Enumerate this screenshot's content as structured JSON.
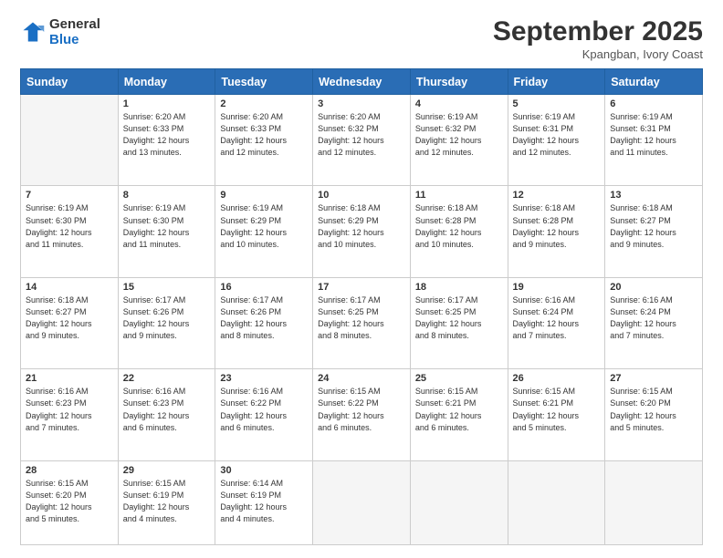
{
  "header": {
    "logo_line1": "General",
    "logo_line2": "Blue",
    "month": "September 2025",
    "location": "Kpangban, Ivory Coast"
  },
  "weekdays": [
    "Sunday",
    "Monday",
    "Tuesday",
    "Wednesday",
    "Thursday",
    "Friday",
    "Saturday"
  ],
  "weeks": [
    [
      {
        "day": "",
        "info": ""
      },
      {
        "day": "1",
        "info": "Sunrise: 6:20 AM\nSunset: 6:33 PM\nDaylight: 12 hours\nand 13 minutes."
      },
      {
        "day": "2",
        "info": "Sunrise: 6:20 AM\nSunset: 6:33 PM\nDaylight: 12 hours\nand 12 minutes."
      },
      {
        "day": "3",
        "info": "Sunrise: 6:20 AM\nSunset: 6:32 PM\nDaylight: 12 hours\nand 12 minutes."
      },
      {
        "day": "4",
        "info": "Sunrise: 6:19 AM\nSunset: 6:32 PM\nDaylight: 12 hours\nand 12 minutes."
      },
      {
        "day": "5",
        "info": "Sunrise: 6:19 AM\nSunset: 6:31 PM\nDaylight: 12 hours\nand 12 minutes."
      },
      {
        "day": "6",
        "info": "Sunrise: 6:19 AM\nSunset: 6:31 PM\nDaylight: 12 hours\nand 11 minutes."
      }
    ],
    [
      {
        "day": "7",
        "info": "Sunrise: 6:19 AM\nSunset: 6:30 PM\nDaylight: 12 hours\nand 11 minutes."
      },
      {
        "day": "8",
        "info": "Sunrise: 6:19 AM\nSunset: 6:30 PM\nDaylight: 12 hours\nand 11 minutes."
      },
      {
        "day": "9",
        "info": "Sunrise: 6:19 AM\nSunset: 6:29 PM\nDaylight: 12 hours\nand 10 minutes."
      },
      {
        "day": "10",
        "info": "Sunrise: 6:18 AM\nSunset: 6:29 PM\nDaylight: 12 hours\nand 10 minutes."
      },
      {
        "day": "11",
        "info": "Sunrise: 6:18 AM\nSunset: 6:28 PM\nDaylight: 12 hours\nand 10 minutes."
      },
      {
        "day": "12",
        "info": "Sunrise: 6:18 AM\nSunset: 6:28 PM\nDaylight: 12 hours\nand 9 minutes."
      },
      {
        "day": "13",
        "info": "Sunrise: 6:18 AM\nSunset: 6:27 PM\nDaylight: 12 hours\nand 9 minutes."
      }
    ],
    [
      {
        "day": "14",
        "info": "Sunrise: 6:18 AM\nSunset: 6:27 PM\nDaylight: 12 hours\nand 9 minutes."
      },
      {
        "day": "15",
        "info": "Sunrise: 6:17 AM\nSunset: 6:26 PM\nDaylight: 12 hours\nand 9 minutes."
      },
      {
        "day": "16",
        "info": "Sunrise: 6:17 AM\nSunset: 6:26 PM\nDaylight: 12 hours\nand 8 minutes."
      },
      {
        "day": "17",
        "info": "Sunrise: 6:17 AM\nSunset: 6:25 PM\nDaylight: 12 hours\nand 8 minutes."
      },
      {
        "day": "18",
        "info": "Sunrise: 6:17 AM\nSunset: 6:25 PM\nDaylight: 12 hours\nand 8 minutes."
      },
      {
        "day": "19",
        "info": "Sunrise: 6:16 AM\nSunset: 6:24 PM\nDaylight: 12 hours\nand 7 minutes."
      },
      {
        "day": "20",
        "info": "Sunrise: 6:16 AM\nSunset: 6:24 PM\nDaylight: 12 hours\nand 7 minutes."
      }
    ],
    [
      {
        "day": "21",
        "info": "Sunrise: 6:16 AM\nSunset: 6:23 PM\nDaylight: 12 hours\nand 7 minutes."
      },
      {
        "day": "22",
        "info": "Sunrise: 6:16 AM\nSunset: 6:23 PM\nDaylight: 12 hours\nand 6 minutes."
      },
      {
        "day": "23",
        "info": "Sunrise: 6:16 AM\nSunset: 6:22 PM\nDaylight: 12 hours\nand 6 minutes."
      },
      {
        "day": "24",
        "info": "Sunrise: 6:15 AM\nSunset: 6:22 PM\nDaylight: 12 hours\nand 6 minutes."
      },
      {
        "day": "25",
        "info": "Sunrise: 6:15 AM\nSunset: 6:21 PM\nDaylight: 12 hours\nand 6 minutes."
      },
      {
        "day": "26",
        "info": "Sunrise: 6:15 AM\nSunset: 6:21 PM\nDaylight: 12 hours\nand 5 minutes."
      },
      {
        "day": "27",
        "info": "Sunrise: 6:15 AM\nSunset: 6:20 PM\nDaylight: 12 hours\nand 5 minutes."
      }
    ],
    [
      {
        "day": "28",
        "info": "Sunrise: 6:15 AM\nSunset: 6:20 PM\nDaylight: 12 hours\nand 5 minutes."
      },
      {
        "day": "29",
        "info": "Sunrise: 6:15 AM\nSunset: 6:19 PM\nDaylight: 12 hours\nand 4 minutes."
      },
      {
        "day": "30",
        "info": "Sunrise: 6:14 AM\nSunset: 6:19 PM\nDaylight: 12 hours\nand 4 minutes."
      },
      {
        "day": "",
        "info": ""
      },
      {
        "day": "",
        "info": ""
      },
      {
        "day": "",
        "info": ""
      },
      {
        "day": "",
        "info": ""
      }
    ]
  ]
}
